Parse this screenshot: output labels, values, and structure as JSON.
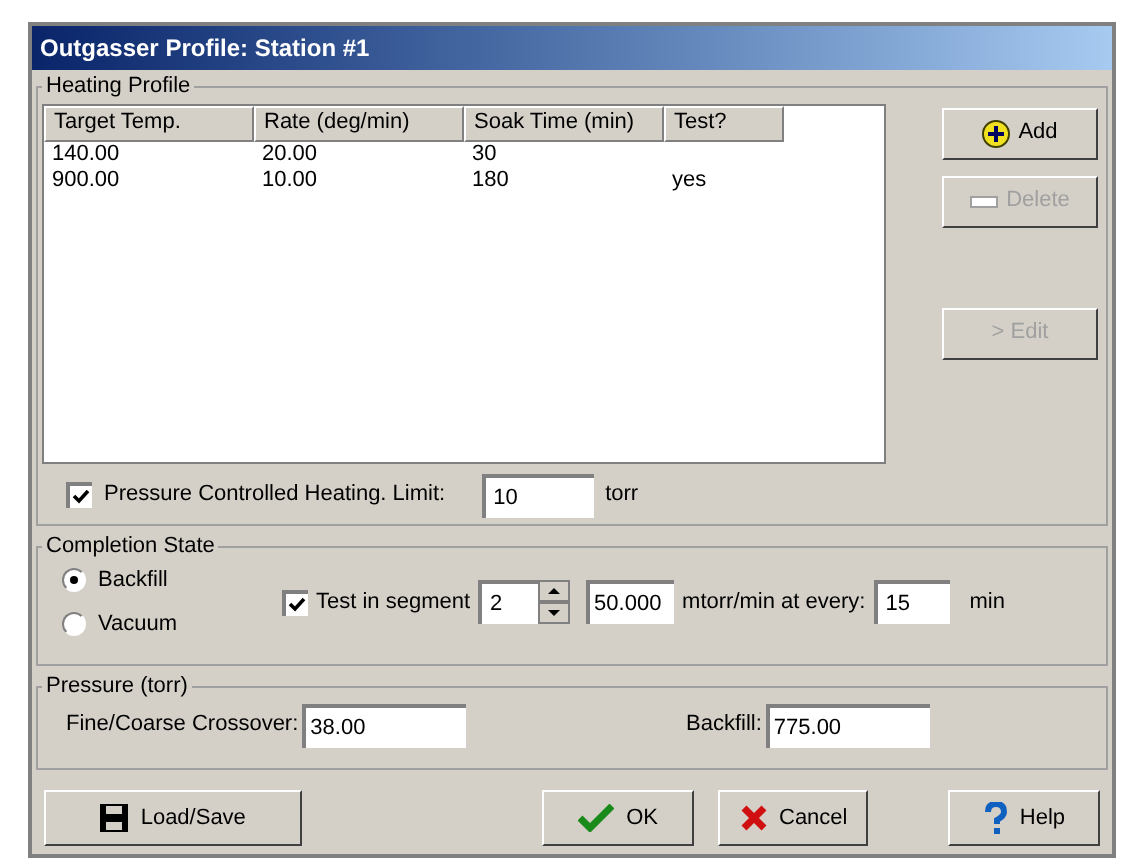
{
  "window": {
    "title": "Outgasser Profile: Station #1"
  },
  "heating_profile": {
    "title": "Heating Profile",
    "columns": [
      "Target Temp.",
      "Rate (deg/min)",
      "Soak Time (min)",
      "Test?"
    ],
    "rows": [
      [
        "140.00",
        "20.00",
        "30",
        ""
      ],
      [
        "900.00",
        "10.00",
        "180",
        "yes"
      ]
    ],
    "buttons": [
      {
        "label": "Add",
        "kind": "add",
        "disabled": false
      },
      {
        "label": "Delete",
        "kind": "delete",
        "disabled": true
      },
      {
        "label": "> Edit",
        "kind": "edit",
        "disabled": true
      }
    ],
    "pressure_controlled": {
      "label": "Pressure Controlled Heating. Limit:",
      "checked": true,
      "value": "10",
      "unit": "torr"
    }
  },
  "completion_state": {
    "title": "Completion State",
    "options": [
      {
        "label": "Backfill",
        "selected": true
      },
      {
        "label": "Vacuum",
        "selected": false
      }
    ],
    "test": {
      "label": "Test in segment",
      "checked": true,
      "segment": "2",
      "rate": "50.000",
      "rate_label": "mtorr/min at every:",
      "interval": "15",
      "unit": "min"
    }
  },
  "pressure": {
    "title": "Pressure (torr)",
    "fields": [
      {
        "label": "Fine/Coarse Crossover:",
        "value": "38.00"
      },
      {
        "label": "Backfill:",
        "value": "775.00"
      }
    ]
  },
  "buttons": [
    {
      "label": "Load/Save",
      "kind": "save"
    },
    {
      "label": "OK",
      "kind": "ok"
    },
    {
      "label": "Cancel",
      "kind": "cancel"
    },
    {
      "label": "Help",
      "kind": "help"
    }
  ]
}
